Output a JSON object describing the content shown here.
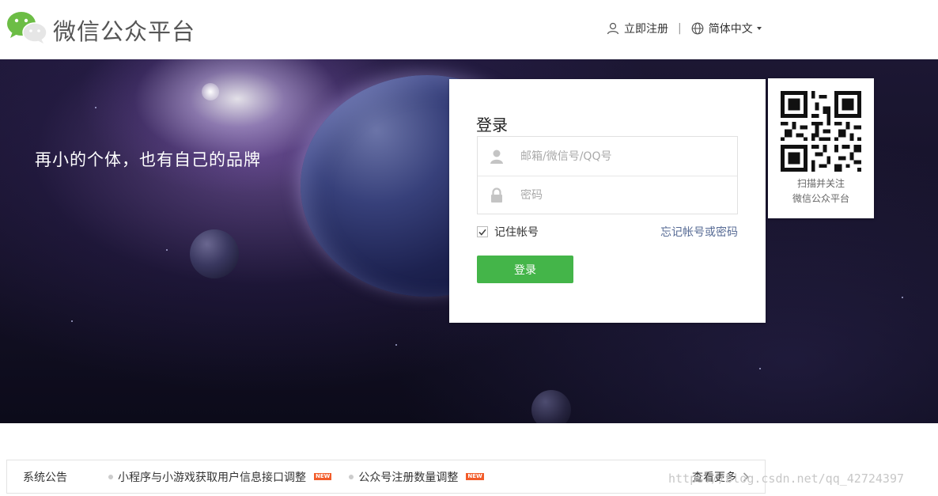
{
  "header": {
    "brand": "微信公众平台",
    "register": "立即注册",
    "separator": "|",
    "language": "简体中文"
  },
  "banner": {
    "slogan": "再小的个体，也有自己的品牌"
  },
  "login": {
    "title": "登录",
    "account_placeholder": "邮箱/微信号/QQ号",
    "password_placeholder": "密码",
    "remember_label": "记住帐号",
    "remember_checked": true,
    "forgot_link": "忘记帐号或密码",
    "submit_label": "登录",
    "accent_color": "#44b549"
  },
  "qr": {
    "line1": "扫描并关注",
    "line2": "微信公众平台"
  },
  "notice": {
    "label": "系统公告",
    "items": [
      {
        "text": "小程序与小游戏获取用户信息接口调整",
        "badge": "NEW"
      },
      {
        "text": "公众号注册数量调整",
        "badge": "NEW"
      }
    ],
    "more": "查看更多"
  },
  "watermark": "https://blog.csdn.net/qq_42724397",
  "icons": [
    "wechat-logo-icon",
    "user-icon",
    "globe-icon",
    "lock-icon",
    "check-icon",
    "qr-code-icon",
    "chevron-right-icon"
  ]
}
